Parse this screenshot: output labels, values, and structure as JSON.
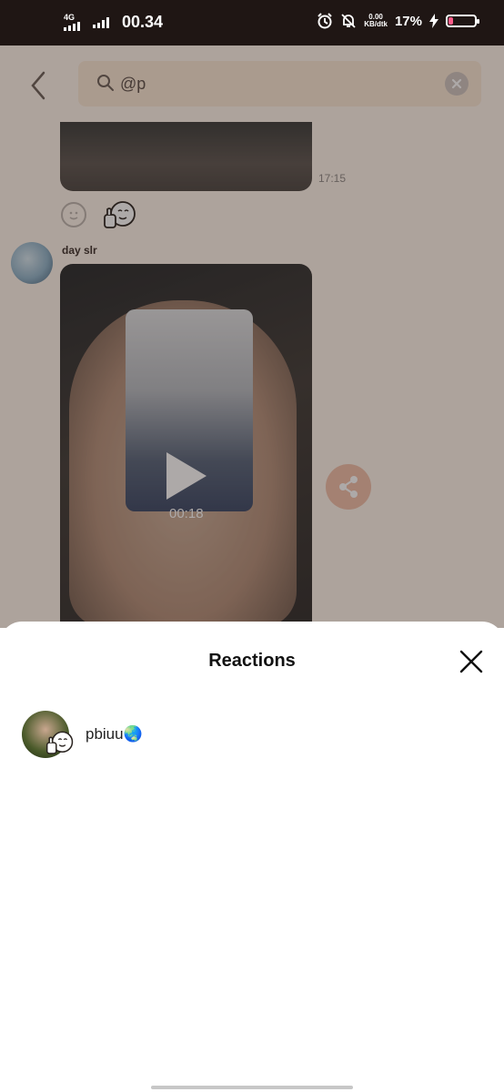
{
  "status_bar": {
    "network_type": "4G",
    "time": "00.34",
    "data_speed_value": "0.00",
    "data_speed_unit": "KB/dtk",
    "battery_percent": "17%",
    "battery_level": 0.17,
    "battery_color": "#ff5d8a",
    "icons": [
      "signal-bars-icon",
      "alarm-icon",
      "mute-bell-icon",
      "charging-icon"
    ]
  },
  "search": {
    "query": "@p"
  },
  "chat": {
    "previous_message_time": "17:15",
    "sender_name": "day slr",
    "video_duration": "00:18"
  },
  "reactions_sheet": {
    "title": "Reactions",
    "reactions": [
      {
        "username": "pbiuu🌏",
        "emoji_icon": "thumbs-up-smiley-icon"
      }
    ]
  }
}
